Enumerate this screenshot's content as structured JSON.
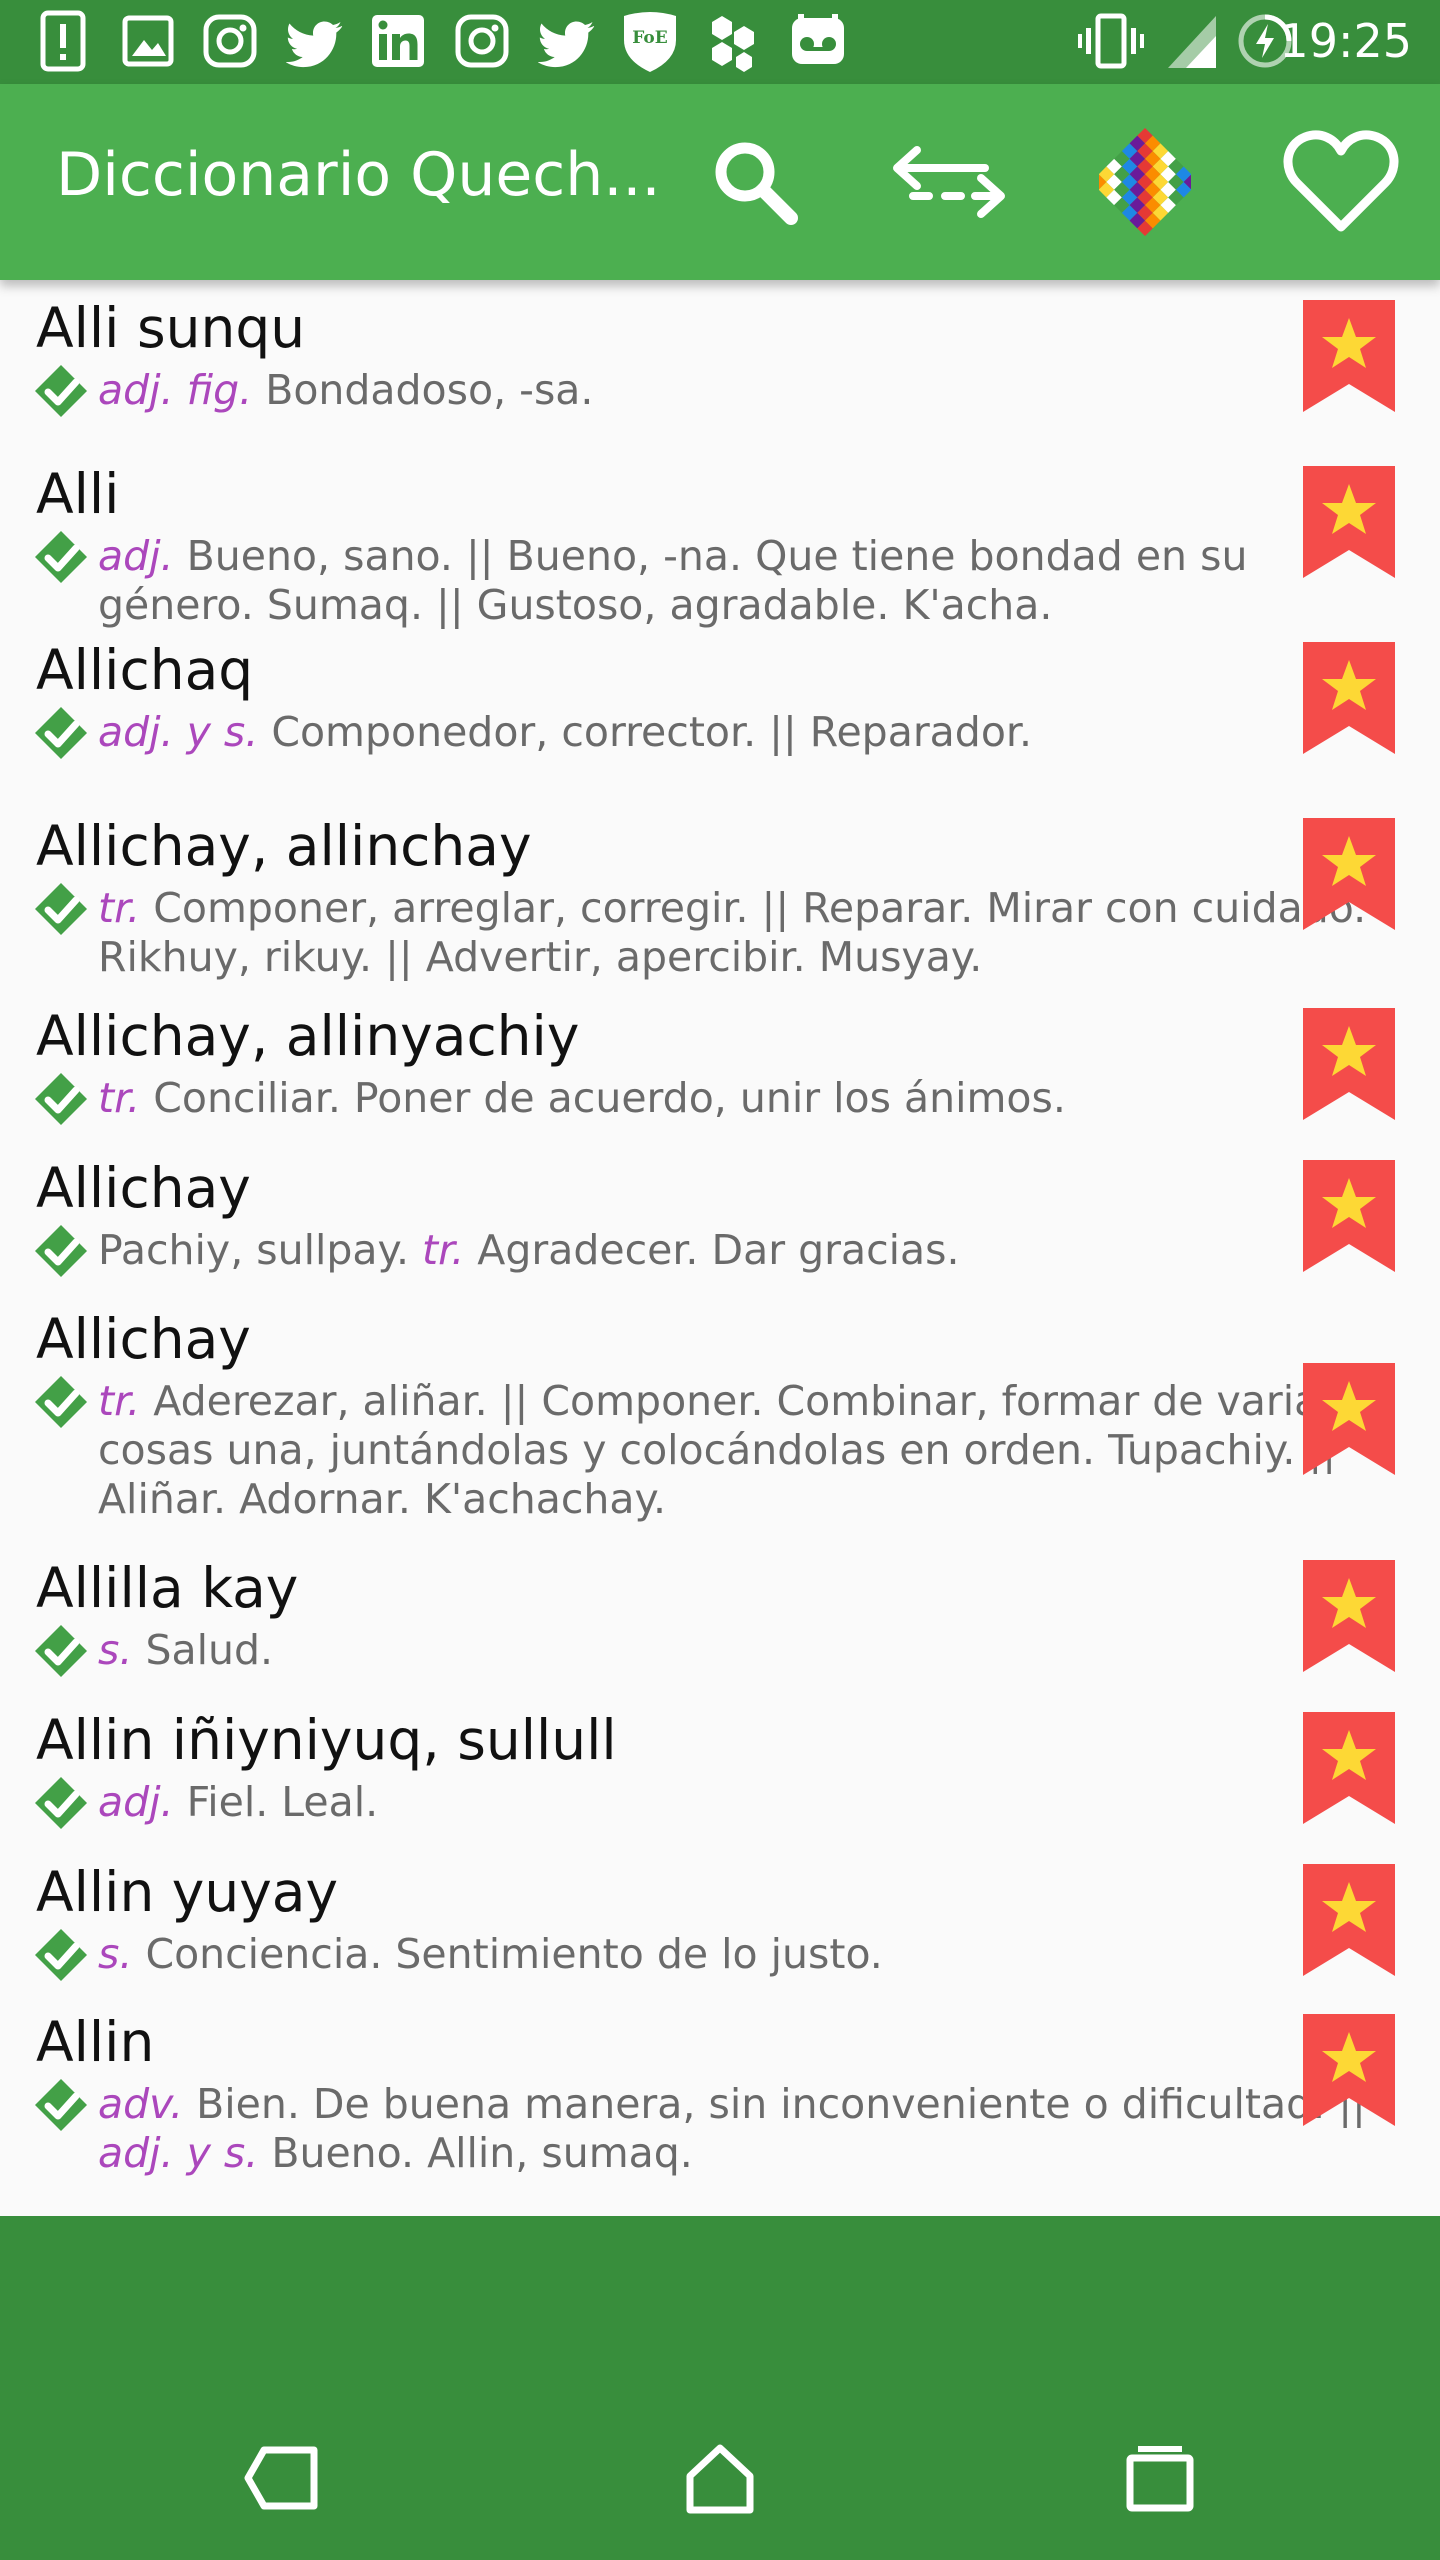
{
  "status_bar": {
    "time": "19:25",
    "left_icons": [
      "alert-icon",
      "image-icon",
      "instagram-icon",
      "twitter-icon",
      "linkedin-icon",
      "instagram-icon",
      "twitter-icon",
      "foe-shield-icon",
      "hexagon-cluster-icon",
      "voicemail-icon"
    ],
    "right_icons": [
      "vibrate-icon",
      "signal-icon",
      "battery-charging-icon"
    ]
  },
  "app_bar": {
    "title": "Diccionario Quech...",
    "actions": [
      "search-icon",
      "swap-direction-icon",
      "wiphala-flag-icon",
      "heart-icon"
    ]
  },
  "entries": [
    {
      "word": "Alli sunqu",
      "lines": [
        [
          {
            "pos": "adj. fig."
          },
          {
            "t": " Bondadoso, -sa."
          }
        ]
      ]
    },
    {
      "word": "Alli",
      "lines": [
        [
          {
            "pos": "adj."
          },
          {
            "t": " Bueno, sano. || Bueno, -na. Que tiene bondad en su"
          }
        ],
        [
          {
            "t": "género. Sumaq. || Gustoso, agradable. K'acha."
          }
        ]
      ]
    },
    {
      "word": "Allichaq",
      "lines": [
        [
          {
            "pos": "adj. y s."
          },
          {
            "t": " Componedor, corrector. || Reparador."
          }
        ]
      ]
    },
    {
      "word": "Allichay, allinchay",
      "lines": [
        [
          {
            "pos": "tr."
          },
          {
            "t": " Componer, arreglar, corregir. || Reparar. Mirar con cuidado."
          }
        ],
        [
          {
            "t": "Rikhuy, rikuy. || Advertir, apercibir. Musyay."
          }
        ]
      ]
    },
    {
      "word": "Allichay, allinyachiy",
      "lines": [
        [
          {
            "pos": "tr."
          },
          {
            "t": " Conciliar. Poner de acuerdo, unir los ánimos."
          }
        ]
      ]
    },
    {
      "word": "Allichay",
      "lines": [
        [
          {
            "t": "Pachiy, sullpay. "
          },
          {
            "pos": "tr."
          },
          {
            "t": " Agradecer. Dar gracias."
          }
        ]
      ]
    },
    {
      "word": "Allichay",
      "lines": [
        [
          {
            "pos": "tr."
          },
          {
            "t": " Aderezar, aliñar. || Componer. Combinar, formar de varias"
          }
        ],
        [
          {
            "t": "cosas una, juntándolas y colocándolas en orden. Tupachiy. ||"
          }
        ],
        [
          {
            "t": "Aliñar. Adornar. K'achachay."
          }
        ]
      ]
    },
    {
      "word": "Allilla kay",
      "lines": [
        [
          {
            "pos": "s."
          },
          {
            "t": " Salud."
          }
        ]
      ]
    },
    {
      "word": "Allin iñiyniyuq, sullull",
      "lines": [
        [
          {
            "pos": "adj."
          },
          {
            "t": " Fiel. Leal."
          }
        ]
      ]
    },
    {
      "word": "Allin yuyay",
      "lines": [
        [
          {
            "pos": "s."
          },
          {
            "t": " Conciencia. Sentimiento de lo justo."
          }
        ]
      ]
    },
    {
      "word": "Allin",
      "lines": [
        [
          {
            "pos": "adv."
          },
          {
            "t": " Bien. De buena manera, sin inconveniente o dificultad. ||"
          }
        ],
        [
          {
            "pos": "adj. y s."
          },
          {
            "t": " Bueno. Allin, sumaq."
          }
        ]
      ]
    }
  ],
  "nav_bar": [
    "back-icon",
    "home-icon",
    "recents-icon"
  ],
  "colors": {
    "status_bar": "#388e3c",
    "app_bar": "#4caf50",
    "bookmark": "#f44c4a",
    "star": "#fdd835",
    "check": "#43a047",
    "pos_text": "#ab47bc",
    "def_text": "#6a6a6a"
  }
}
